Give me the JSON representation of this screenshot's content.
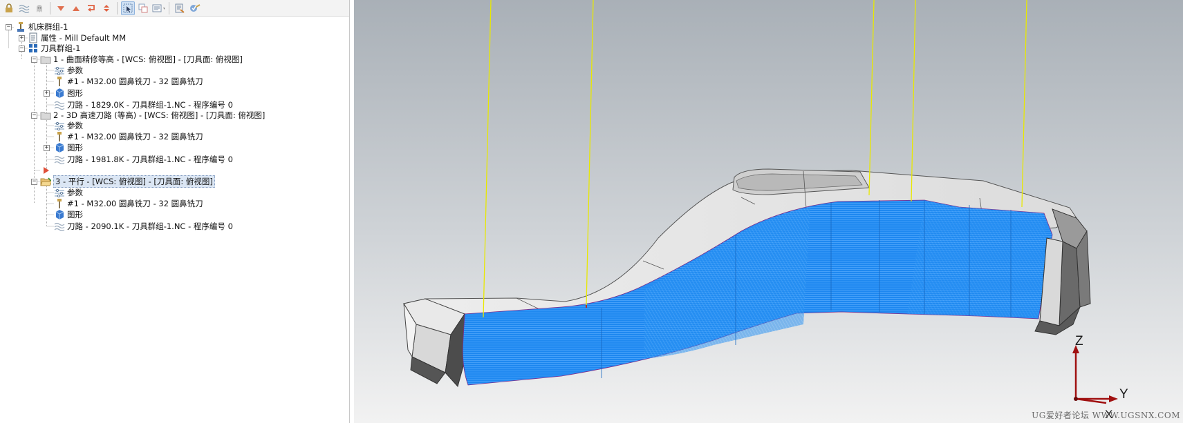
{
  "toolbar": {
    "buttons": [
      {
        "icon": "lock-icon"
      },
      {
        "icon": "toolpath-toggle-icon"
      },
      {
        "icon": "ghost-icon"
      },
      {
        "icon": "move-down-icon"
      },
      {
        "icon": "move-up-icon"
      },
      {
        "icon": "insert-arrow-icon"
      },
      {
        "icon": "expand-collapse-icon"
      },
      {
        "icon": "select-cursor-icon"
      },
      {
        "icon": "copy-icon"
      },
      {
        "icon": "display-options-icon"
      },
      {
        "icon": "regenerate-icon"
      },
      {
        "icon": "verify-icon"
      }
    ]
  },
  "tree": {
    "root": "机床群组-1",
    "properties": "属性 - Mill Default MM",
    "tool_group": "刀具群组-1",
    "op1": {
      "title": "1 - 曲面精修等高 - [WCS: 俯视图] - [刀具面: 俯视图]",
      "params": "参数",
      "tool": "#1 - M32.00 圆鼻铣刀 - 32 圆鼻铣刀",
      "geometry": "图形",
      "toolpath": "刀路 - 1829.0K - 刀具群组-1.NC - 程序编号 0"
    },
    "op2": {
      "title": "2 - 3D 高速刀路 (等高) - [WCS: 俯视图] - [刀具面: 俯视图]",
      "params": "参数",
      "tool": "#1 - M32.00 圆鼻铣刀 - 32 圆鼻铣刀",
      "geometry": "图形",
      "toolpath": "刀路 - 1981.8K - 刀具群组-1.NC - 程序编号 0"
    },
    "op3": {
      "title": "3 - 平行 - [WCS: 俯视图] - [刀具面: 俯视图]",
      "params": "参数",
      "tool": "#1 - M32.00 圆鼻铣刀 - 32 圆鼻铣刀",
      "geometry": "图形",
      "toolpath": "刀路 - 2090.1K - 刀具群组-1.NC - 程序编号 0"
    }
  },
  "viewport": {
    "axis_z": "Z",
    "axis_y": "Y",
    "axis_x": "X",
    "watermark": "UG爱好者论坛 WWW.UGSNX.COM",
    "colors": {
      "toolpath": "#1e88f0",
      "plunge_line": "#e8e800",
      "part_light": "#e6e6e6",
      "part_dark": "#6e6e6e",
      "axis": "#a01010"
    }
  }
}
